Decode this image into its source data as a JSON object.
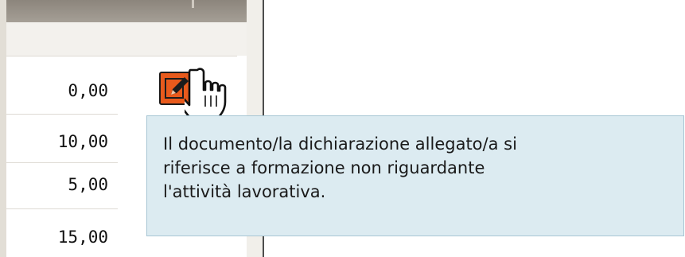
{
  "table": {
    "values": [
      "0,00",
      "10,00",
      "5,00",
      "15,00"
    ]
  },
  "icons": {
    "edit": "pencil-edit-icon",
    "cursor": "hand-pointer-icon"
  },
  "tooltip": {
    "lines": [
      "Il documento/la dichiarazione allegato/a si",
      "riferisce a formazione non riguardante",
      "l'attività lavorativa."
    ]
  },
  "colors": {
    "edit_icon_bg": "#e85a1c",
    "tooltip_bg": "#dcebf1",
    "tooltip_border": "#a8c6d4",
    "header_bar": "#9a948b"
  }
}
